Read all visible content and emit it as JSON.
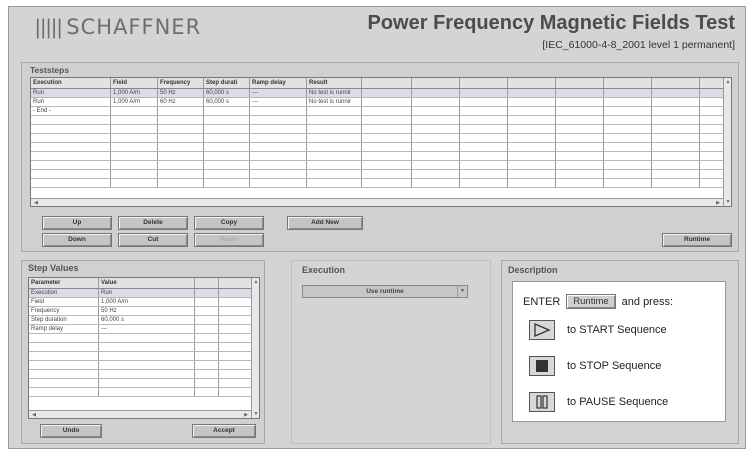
{
  "header": {
    "logo_bars": "|||||",
    "brand": "SCHAFFNER",
    "title": "Power Frequency Magnetic Fields  Test",
    "subtitle": "[IEC_61000-4-8_2001 level 1 permanent]"
  },
  "teststeps": {
    "title": "Teststeps",
    "columns": [
      "Execution",
      "Field",
      "Frequency",
      "Step durati",
      "Ramp delay",
      "Result",
      "",
      "",
      "",
      "",
      "",
      "",
      "",
      ""
    ],
    "rows": [
      [
        "Run",
        "1,000 A/m",
        "50 Hz",
        "60,000 s",
        "---",
        "No test is runnir",
        "",
        "",
        "",
        "",
        "",
        "",
        "",
        ""
      ],
      [
        "Run",
        "1,000 A/m",
        "60 Hz",
        "60,000 s",
        "---",
        "No test is runnir",
        "",
        "",
        "",
        "",
        "",
        "",
        "",
        ""
      ],
      [
        "- End -",
        "",
        "",
        "",
        "",
        "",
        "",
        "",
        "",
        "",
        "",
        "",
        "",
        ""
      ]
    ],
    "buttons": {
      "up": "Up",
      "delete": "Delete",
      "copy": "Copy",
      "add_new": "Add New",
      "down": "Down",
      "cut": "Cut",
      "paste": "Paste",
      "runtime": "Runtime"
    }
  },
  "step_values": {
    "title": "Step Values",
    "columns": [
      "Parameter",
      "Value",
      "",
      ""
    ],
    "rows": [
      [
        "Execution",
        "Run",
        "",
        ""
      ],
      [
        "Field",
        "1,000 A/m",
        "",
        ""
      ],
      [
        "Frequency",
        "50 Hz",
        "",
        ""
      ],
      [
        "Step duration",
        "60,000 s",
        "",
        ""
      ],
      [
        "Ramp delay",
        "---",
        "",
        ""
      ]
    ],
    "buttons": {
      "undo": "Undo",
      "accept": "Accept"
    }
  },
  "execution": {
    "title": "Execution",
    "selected": "Use runtime"
  },
  "description": {
    "title": "Description",
    "enter": "ENTER",
    "runtime_button": "Runtime",
    "and_press": "and press:",
    "start": "to START Sequence",
    "stop": "to STOP Sequence",
    "pause": "to PAUSE Sequence"
  }
}
